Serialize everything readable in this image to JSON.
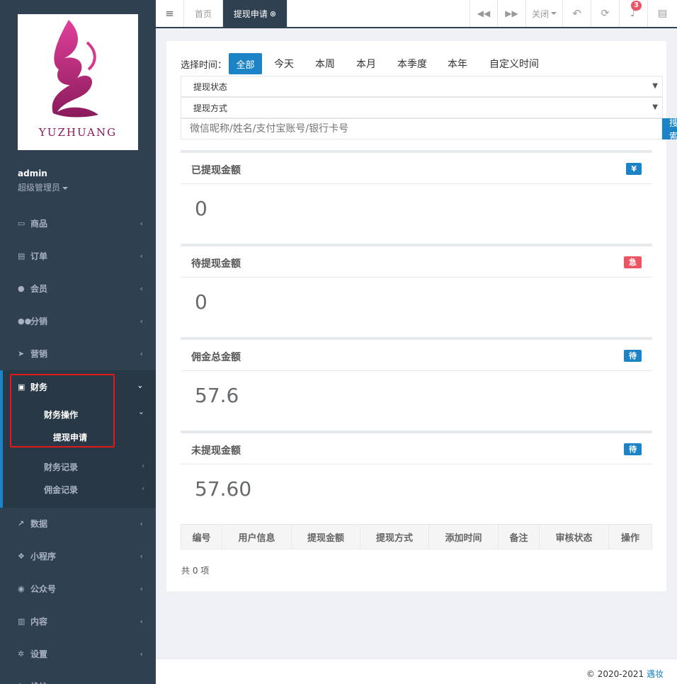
{
  "sidebar": {
    "logo_text": "YUZHUANG",
    "user_name": "admin",
    "user_role": "超级管理员",
    "items": [
      {
        "label": "商品",
        "icon": "laptop-icon"
      },
      {
        "label": "订单",
        "icon": "list-icon"
      },
      {
        "label": "会员",
        "icon": "user-icon"
      },
      {
        "label": "分销",
        "icon": "users-icon"
      },
      {
        "label": "营销",
        "icon": "send-icon"
      },
      {
        "label": "财务",
        "icon": "money-icon"
      },
      {
        "label": "数据",
        "icon": "chart-icon"
      },
      {
        "label": "小程序",
        "icon": "cubes-icon"
      },
      {
        "label": "公众号",
        "icon": "wechat-icon"
      },
      {
        "label": "内容",
        "icon": "book-icon"
      },
      {
        "label": "设置",
        "icon": "gear-icon"
      },
      {
        "label": "维护",
        "icon": "wrench-icon"
      }
    ],
    "finance_sub": {
      "ops": "财务操作",
      "withdraw": "提现申请",
      "records": "财务记录",
      "commission": "佣金记录"
    }
  },
  "topbar": {
    "home_tab": "首页",
    "active_tab": "提现申请",
    "close_label": "关闭",
    "notification_count": "3"
  },
  "filter": {
    "label": "选择时间：",
    "times": [
      "全部",
      "今天",
      "本周",
      "本月",
      "本季度",
      "本年",
      "自定义时间"
    ],
    "status_select": "提现状态",
    "method_select": "提现方式",
    "search_placeholder": "微信昵称/姓名/支付宝账号/银行卡号",
    "search_button": "搜索"
  },
  "stats": [
    {
      "title": "已提现金额",
      "badge": "¥",
      "value": "0",
      "color": "#1c84c6"
    },
    {
      "title": "待提现金额",
      "badge": "急",
      "value": "0",
      "color": "#ed5565"
    },
    {
      "title": "佣金总金额",
      "badge": "待",
      "value": "57.6",
      "color": "#1c84c6"
    },
    {
      "title": "未提现金额",
      "badge": "待",
      "value": "57.60",
      "color": "#1c84c6"
    }
  ],
  "table": {
    "headers": [
      "编号",
      "用户信息",
      "提现金额",
      "提现方式",
      "添加时间",
      "备注",
      "审核状态",
      "操作"
    ],
    "total": "共 0 项"
  },
  "footer": {
    "copyright": "© 2020-2021 ",
    "brand": "遇妆"
  }
}
